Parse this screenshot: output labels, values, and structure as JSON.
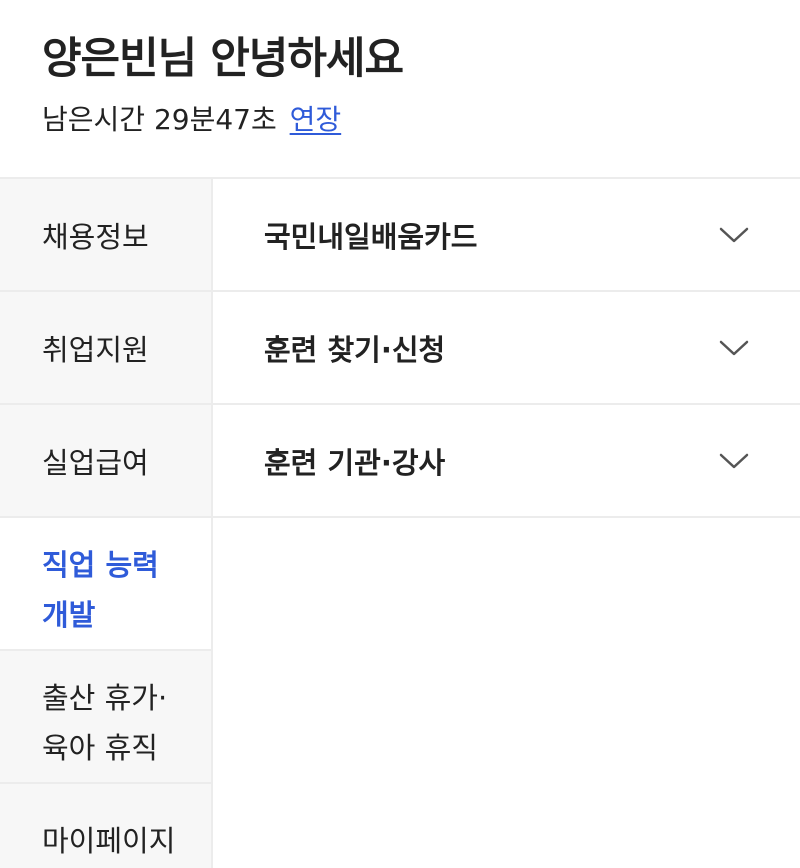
{
  "header": {
    "greeting": "양은빈님 안녕하세요",
    "timer_label": "남은시간 29분47초",
    "extend_label": "연장"
  },
  "left_nav": {
    "items": [
      {
        "label": "채용정보"
      },
      {
        "label": "취업지원"
      },
      {
        "label": "실업급여"
      },
      {
        "label_line1": "직업 능력",
        "label_line2": "개발",
        "active": true
      },
      {
        "label_line1": "출산 휴가·",
        "label_line2": "육아 휴직"
      },
      {
        "label": "마이페이지"
      }
    ]
  },
  "sub_menu": {
    "items": [
      {
        "label": "국민내일배움카드",
        "icon": "chevron-down-icon"
      },
      {
        "label": "훈련 찾기·신청",
        "icon": "chevron-down-icon"
      },
      {
        "label": "훈련 기관·강사",
        "icon": "chevron-down-icon"
      }
    ]
  },
  "colors": {
    "accent": "#2f5bd9",
    "text": "#222222",
    "nav_bg": "#f7f7f7",
    "divider": "#ececec"
  }
}
